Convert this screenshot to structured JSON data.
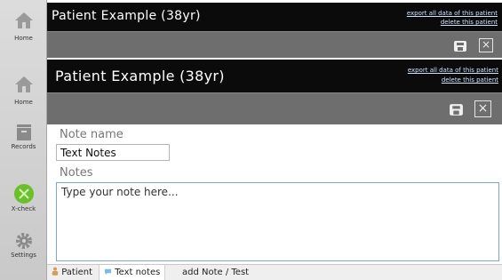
{
  "sidebar": {
    "items": [
      {
        "label": "Home"
      },
      {
        "label": "Home"
      },
      {
        "label": "Records"
      },
      {
        "label": "X-check"
      },
      {
        "label": "Settings"
      }
    ]
  },
  "header_top": {
    "title": "Patient Example (38yr)",
    "export_link": "export all data of this patient",
    "delete_link": "delete this patient"
  },
  "header_main": {
    "title": "Patient Example (38yr)",
    "export_link": "export all data of this patient",
    "delete_link": "delete this patient"
  },
  "form": {
    "note_name_label": "Note name",
    "note_name_value": "Text Notes",
    "notes_label": "Notes",
    "notes_placeholder": "Type your note here..."
  },
  "tabs": [
    {
      "label": "Patient"
    },
    {
      "label": "Text notes"
    },
    {
      "label": "add Note / Test"
    }
  ],
  "colors": {
    "header": "#0b0b0b",
    "toolbar": "#6e6e6e",
    "accent": "#6bbf2a"
  }
}
